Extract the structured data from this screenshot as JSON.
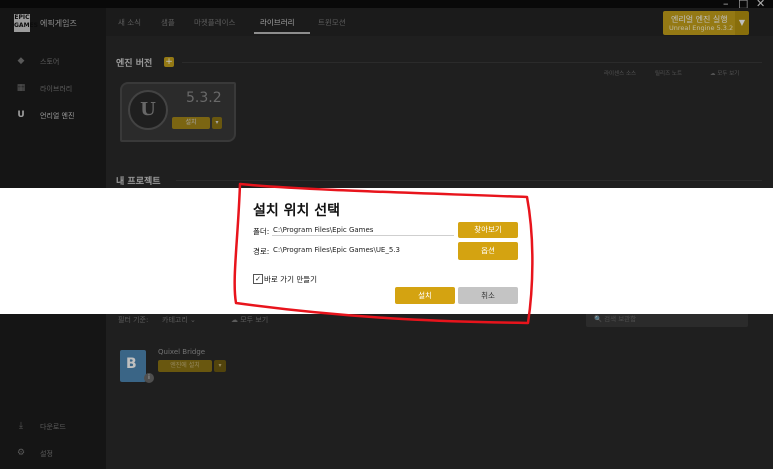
{
  "window": {
    "minimize": "–",
    "maximize": "□",
    "close": "✕"
  },
  "sidebar": {
    "logo": "EPIC GAMES",
    "brand": "에픽게임즈",
    "items": [
      {
        "label": "스토어",
        "icon": "tag-icon"
      },
      {
        "label": "라이브러리",
        "icon": "grid-icon"
      },
      {
        "label": "언리얼 엔진",
        "icon": "unreal-icon"
      }
    ],
    "bottom_items": [
      {
        "label": "다운로드",
        "icon": "download-icon"
      },
      {
        "label": "설정",
        "icon": "gear-icon"
      }
    ]
  },
  "topnav": {
    "tabs": [
      "새 소식",
      "샘플",
      "마켓플레이스",
      "라이브러리",
      "트윈모션"
    ],
    "active_tab": "라이브러리",
    "launch_button": {
      "line1": "엔리얼 엔진 실행",
      "line2": "Unreal Engine 5.3.2"
    }
  },
  "engine_section": {
    "title": "엔진 버전",
    "links": [
      "라이센스 소스",
      "릴리즈 노트",
      "모두 보기"
    ],
    "engine_version": "5.3.2",
    "install_label": "설치"
  },
  "projects_section": {
    "title": "내 프로젝트"
  },
  "plugins_section": {
    "filter_label": "필터 기준:",
    "category_label": "카테고리",
    "vault_label": "모두 보기",
    "search_placeholder": "검색 보관함",
    "plugin_name": "Quixel Bridge",
    "plugin_button": "엔진에 설치"
  },
  "dialog": {
    "title": "설치 위치 선택",
    "folder_label": "폴더:",
    "folder_value": "C:\\Program Files\\Epic Games",
    "path_label": "경로:",
    "path_value": "C:\\Program Files\\Epic Games\\UE_5.3",
    "browse_button": "찾아보기",
    "options_button": "옵션",
    "shortcut_label": "바로 가기 만들기",
    "shortcut_checked": true,
    "install_button": "설치",
    "cancel_button": "취소"
  },
  "colors": {
    "accent": "#d4a311",
    "annotation": "#e8141c"
  }
}
